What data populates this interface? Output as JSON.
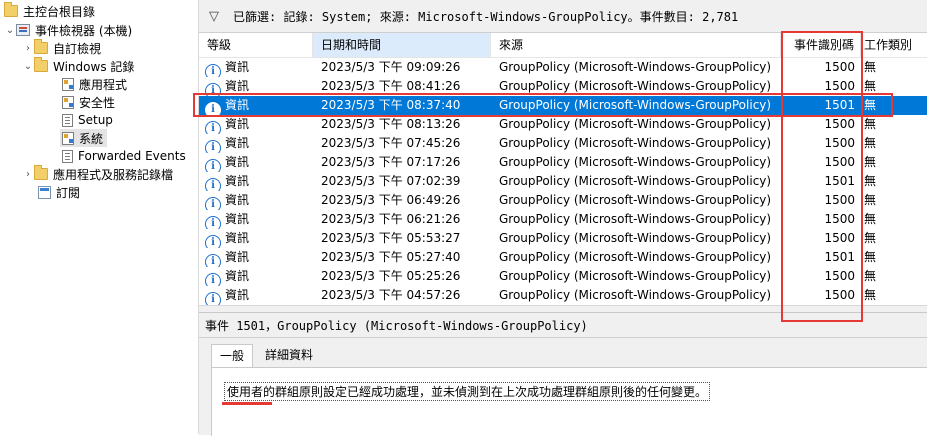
{
  "tree": {
    "root": "主控台根目錄",
    "viewer": "事件檢視器 (本機)",
    "custom_views": "自訂檢視",
    "windows_logs": "Windows 記錄",
    "application": "應用程式",
    "security": "安全性",
    "setup": "Setup",
    "system": "系統",
    "forwarded": "Forwarded Events",
    "app_services": "應用程式及服務記錄檔",
    "subscriptions": "訂閱"
  },
  "filter": {
    "text": "已篩選: 記錄: System; 來源: Microsoft-Windows-GroupPolicy。事件數目: 2,781"
  },
  "grid": {
    "columns": [
      "等級",
      "日期和時間",
      "來源",
      "事件識別碼",
      "工作類別"
    ],
    "rows": [
      {
        "level": "資訊",
        "datetime": "2023/5/3 下午 09:09:26",
        "source": "GroupPolicy (Microsoft-Windows-GroupPolicy)",
        "id": "1500",
        "task": "無"
      },
      {
        "level": "資訊",
        "datetime": "2023/5/3 下午 08:41:26",
        "source": "GroupPolicy (Microsoft-Windows-GroupPolicy)",
        "id": "1500",
        "task": "無"
      },
      {
        "level": "資訊",
        "datetime": "2023/5/3 下午 08:37:40",
        "source": "GroupPolicy (Microsoft-Windows-GroupPolicy)",
        "id": "1501",
        "task": "無",
        "selected": true
      },
      {
        "level": "資訊",
        "datetime": "2023/5/3 下午 08:13:26",
        "source": "GroupPolicy (Microsoft-Windows-GroupPolicy)",
        "id": "1500",
        "task": "無"
      },
      {
        "level": "資訊",
        "datetime": "2023/5/3 下午 07:45:26",
        "source": "GroupPolicy (Microsoft-Windows-GroupPolicy)",
        "id": "1500",
        "task": "無"
      },
      {
        "level": "資訊",
        "datetime": "2023/5/3 下午 07:17:26",
        "source": "GroupPolicy (Microsoft-Windows-GroupPolicy)",
        "id": "1500",
        "task": "無"
      },
      {
        "level": "資訊",
        "datetime": "2023/5/3 下午 07:02:39",
        "source": "GroupPolicy (Microsoft-Windows-GroupPolicy)",
        "id": "1501",
        "task": "無"
      },
      {
        "level": "資訊",
        "datetime": "2023/5/3 下午 06:49:26",
        "source": "GroupPolicy (Microsoft-Windows-GroupPolicy)",
        "id": "1500",
        "task": "無"
      },
      {
        "level": "資訊",
        "datetime": "2023/5/3 下午 06:21:26",
        "source": "GroupPolicy (Microsoft-Windows-GroupPolicy)",
        "id": "1500",
        "task": "無"
      },
      {
        "level": "資訊",
        "datetime": "2023/5/3 下午 05:53:27",
        "source": "GroupPolicy (Microsoft-Windows-GroupPolicy)",
        "id": "1500",
        "task": "無"
      },
      {
        "level": "資訊",
        "datetime": "2023/5/3 下午 05:27:40",
        "source": "GroupPolicy (Microsoft-Windows-GroupPolicy)",
        "id": "1501",
        "task": "無"
      },
      {
        "level": "資訊",
        "datetime": "2023/5/3 下午 05:25:26",
        "source": "GroupPolicy (Microsoft-Windows-GroupPolicy)",
        "id": "1500",
        "task": "無"
      },
      {
        "level": "資訊",
        "datetime": "2023/5/3 下午 04:57:26",
        "source": "GroupPolicy (Microsoft-Windows-GroupPolicy)",
        "id": "1500",
        "task": "無"
      }
    ]
  },
  "detail": {
    "title": "事件 1501，GroupPolicy (Microsoft-Windows-GroupPolicy)",
    "tab_general": "一般",
    "tab_details": "詳細資料",
    "message": "使用者的群組原則設定已經成功處理，並未偵測到在上次成功處理群組原則後的任何變更。"
  },
  "colors": {
    "selection": "#0078d7",
    "annotation": "#e53935",
    "info_icon": "#1e6fc9"
  }
}
